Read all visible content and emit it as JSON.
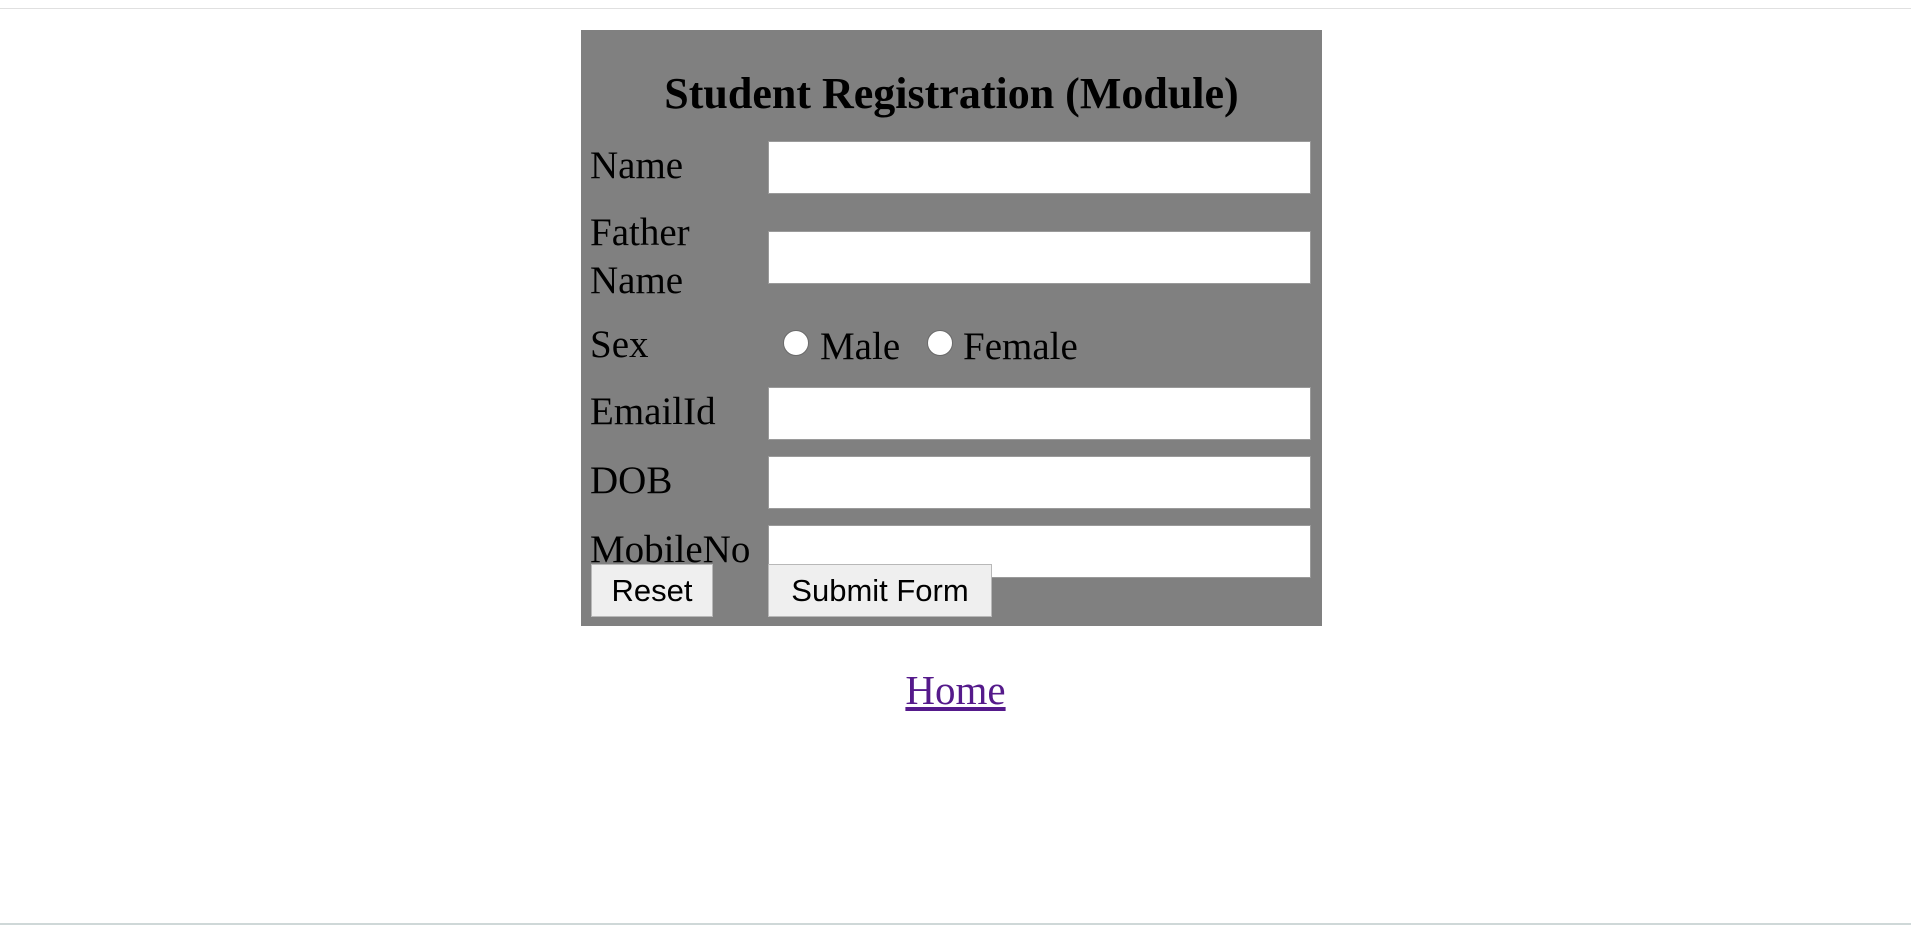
{
  "form": {
    "title": "Student Registration (Module)",
    "fields": {
      "name": {
        "label": "Name",
        "value": ""
      },
      "father_name": {
        "label_line1": "Father",
        "label_line2": "Name",
        "value": ""
      },
      "sex": {
        "label": "Sex",
        "options": [
          {
            "label": "Male",
            "selected": false
          },
          {
            "label": "Female",
            "selected": false
          }
        ]
      },
      "email": {
        "label": "EmailId",
        "value": ""
      },
      "dob": {
        "label": "DOB",
        "value": ""
      },
      "mobile": {
        "label": "MobileNo",
        "value": ""
      }
    },
    "buttons": {
      "reset_label": "Reset",
      "submit_label": "Submit Form"
    }
  },
  "footer": {
    "home_link": "Home"
  },
  "colors": {
    "panel_bg": "#808080",
    "link_visited": "#551a8b",
    "button_bg": "#efefef"
  }
}
